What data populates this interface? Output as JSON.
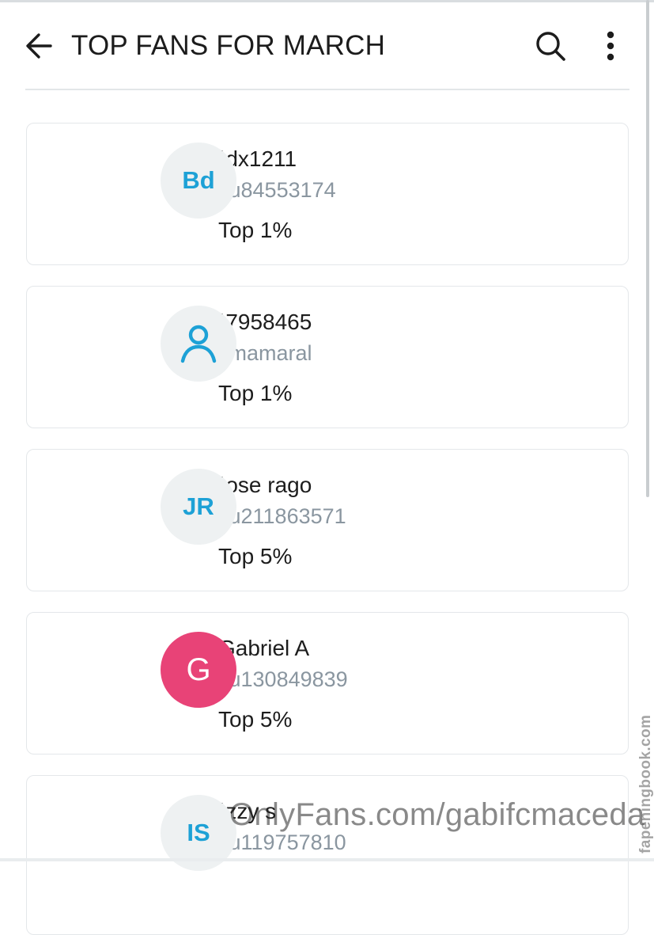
{
  "header": {
    "title": "TOP FANS FOR MARCH",
    "back_icon": "arrow-left-icon",
    "search_icon": "search-icon",
    "more_icon": "more-vertical-icon"
  },
  "fans": [
    {
      "avatar_text": "Bd",
      "avatar_style": "initials",
      "name": "ˈdx1211",
      "handle": "ɔu84553174",
      "rank": "Top 1%"
    },
    {
      "avatar_text": "",
      "avatar_style": "person-icon",
      "name": "ˈ7958465",
      "handle": "ɔmamaral",
      "rank": "Top 1%"
    },
    {
      "avatar_text": "JR",
      "avatar_style": "initials",
      "name": "ˈose rago",
      "handle": "ɔu211863571",
      "rank": "Top 5%"
    },
    {
      "avatar_text": "G",
      "avatar_style": "initials-pink",
      "name": "Gabriel A",
      "handle": "ɔu130849839",
      "rank": "Top 5%"
    },
    {
      "avatar_text": "IS",
      "avatar_style": "initials",
      "name": "ˈzzy s",
      "handle": "ɔu119757810",
      "rank": ""
    }
  ],
  "watermark": "OnlyFans.com/gabifcmaceda",
  "side_watermark": "fapeningbook.com",
  "colors": {
    "accent": "#1da1d6",
    "avatar_bg": "#eef1f2",
    "pink_avatar": "#e84377",
    "muted_text": "#8a96a0"
  }
}
